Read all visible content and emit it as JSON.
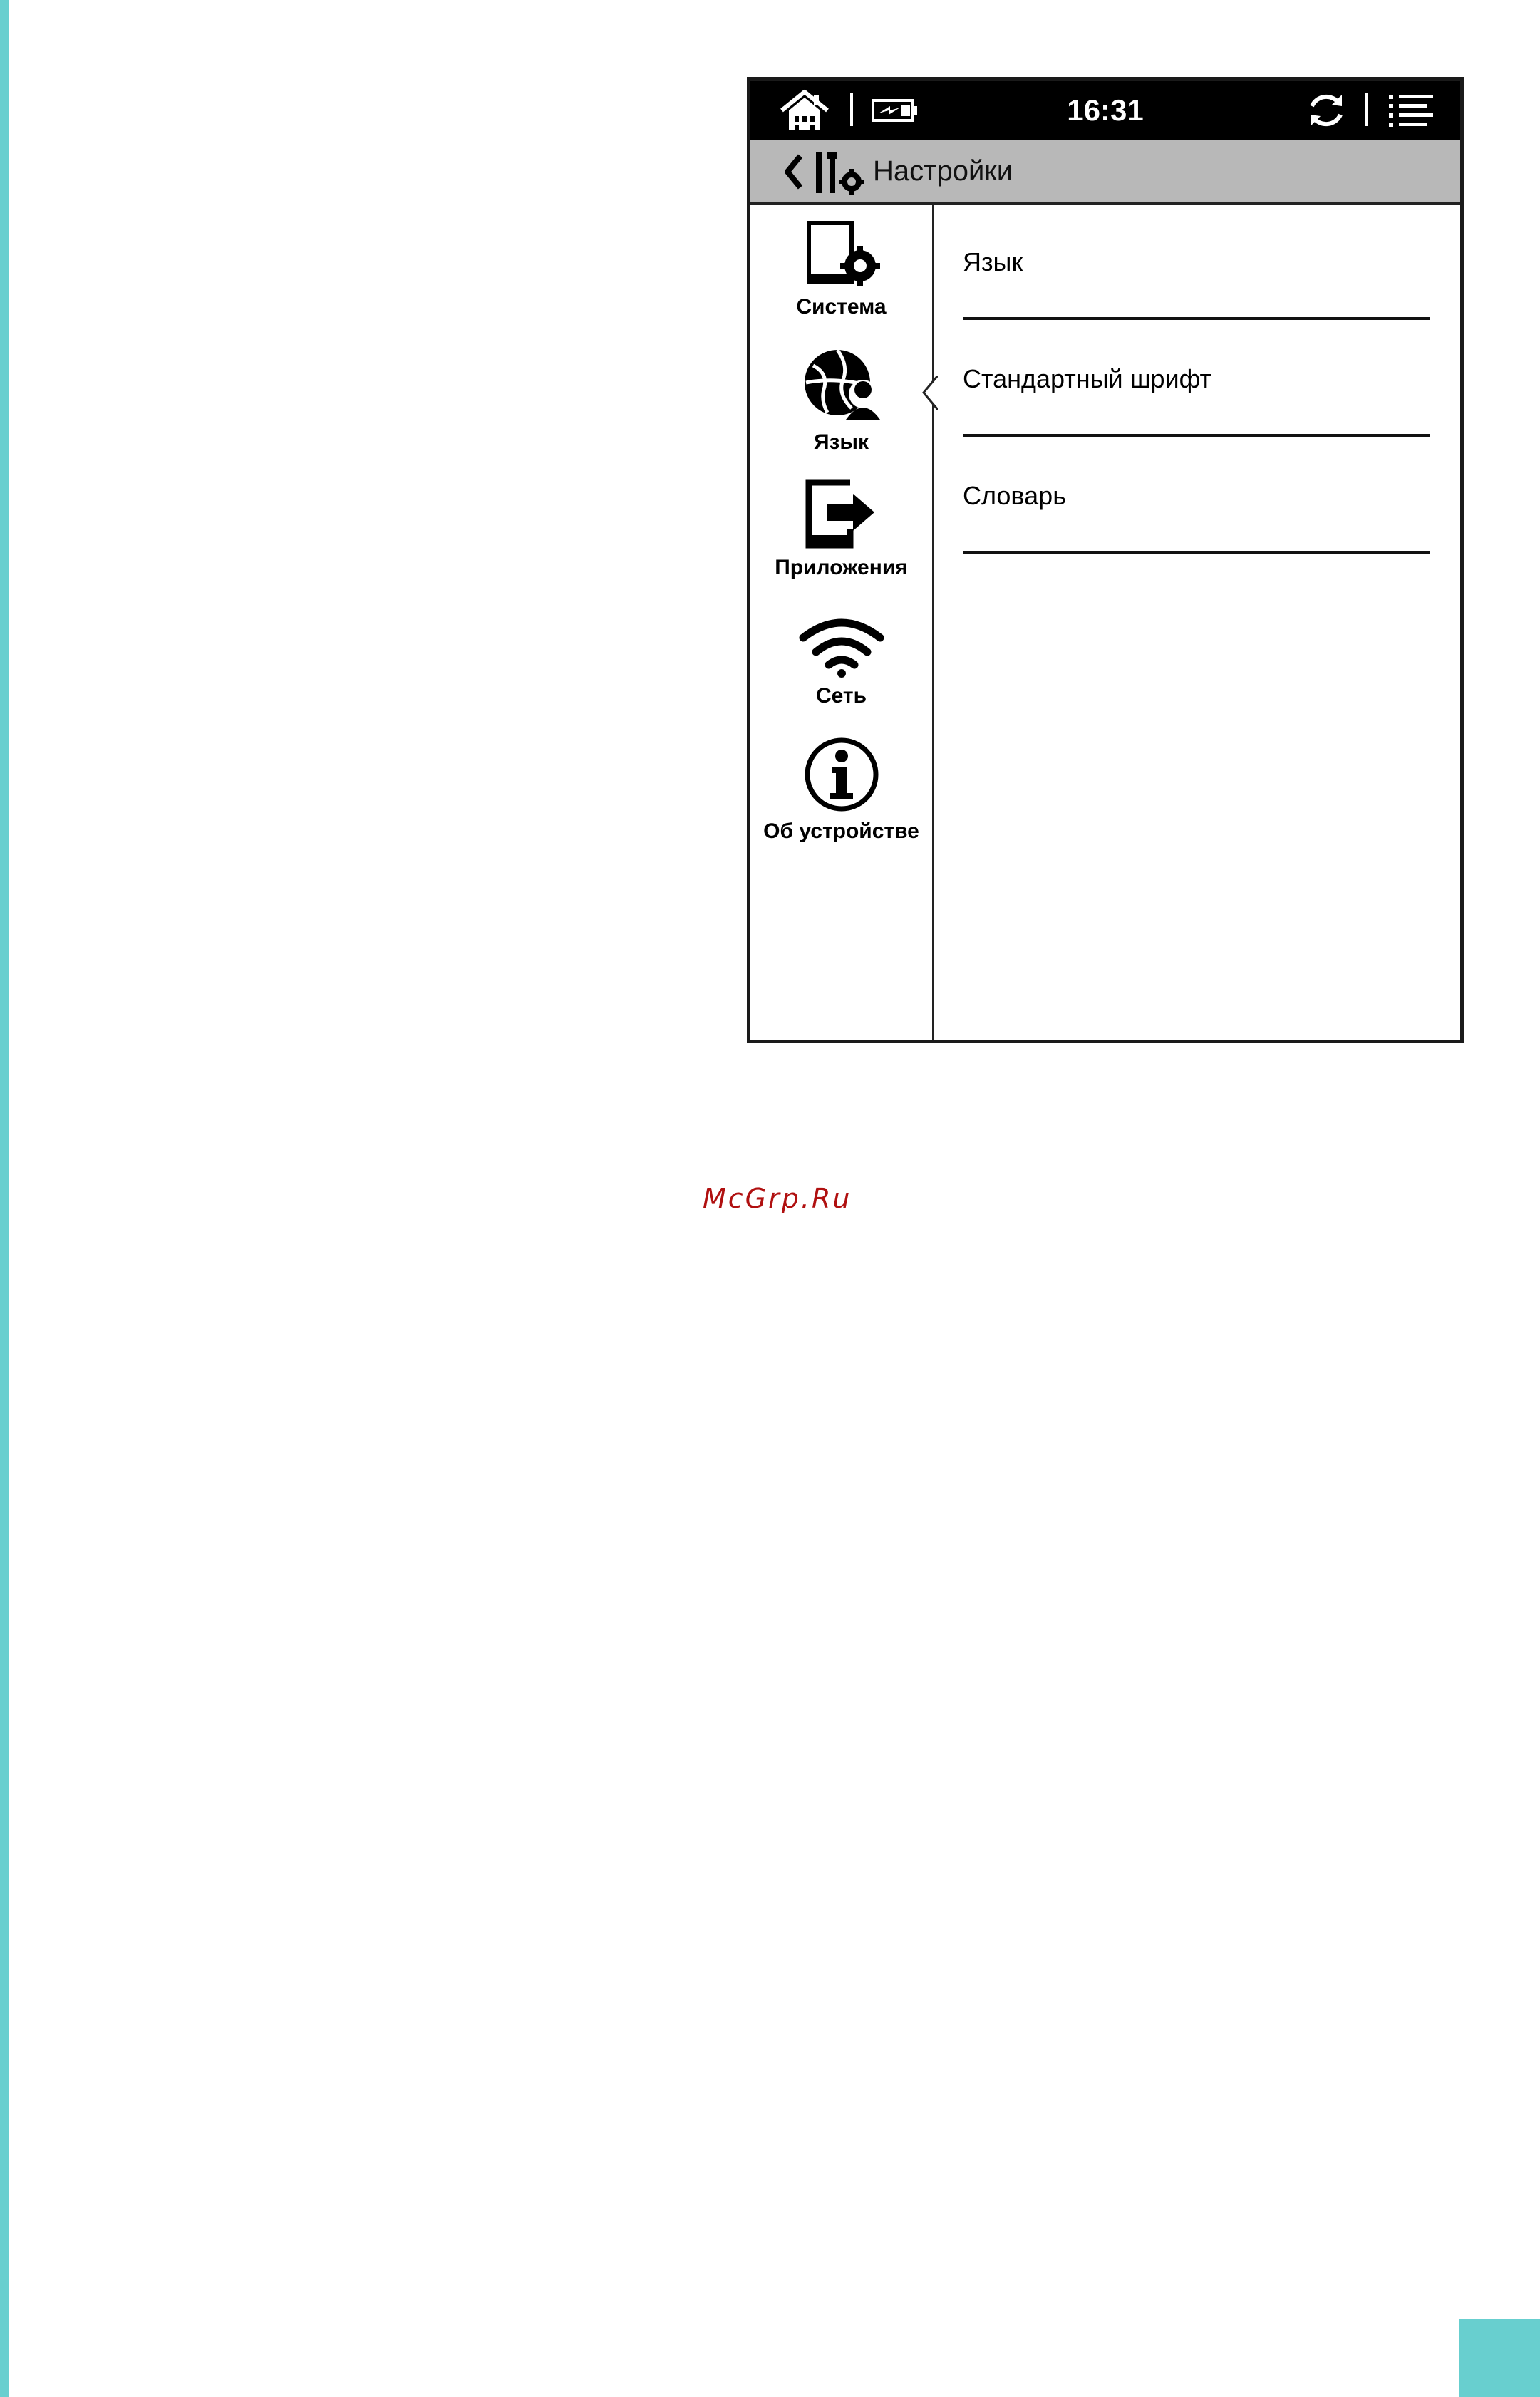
{
  "statusbar": {
    "time": "16:31",
    "icons": {
      "home": "home-icon",
      "battery": "battery-charging-icon",
      "sync": "sync-icon",
      "menu": "menu-list-icon"
    }
  },
  "titlebar": {
    "title": "Настройки",
    "back_icon": "chevron-left-icon",
    "settings_icon": "tools-gear-icon"
  },
  "sidebar": {
    "items": [
      {
        "label": "Система",
        "icon": "tablet-gear-icon"
      },
      {
        "label": "Язык",
        "icon": "globe-user-icon",
        "selected": true
      },
      {
        "label": "Приложения",
        "icon": "app-export-icon"
      },
      {
        "label": "Сеть",
        "icon": "wifi-icon"
      },
      {
        "label": "Об устройстве",
        "icon": "info-icon"
      }
    ]
  },
  "content": {
    "settings": [
      {
        "label": "Язык"
      },
      {
        "label": "Стандартный шрифт"
      },
      {
        "label": "Словарь"
      }
    ]
  },
  "watermark": "McGrp.Ru",
  "colors": {
    "accent": "#68cfcf",
    "watermark": "#b01010",
    "titlebar": "#b8b8b8"
  }
}
